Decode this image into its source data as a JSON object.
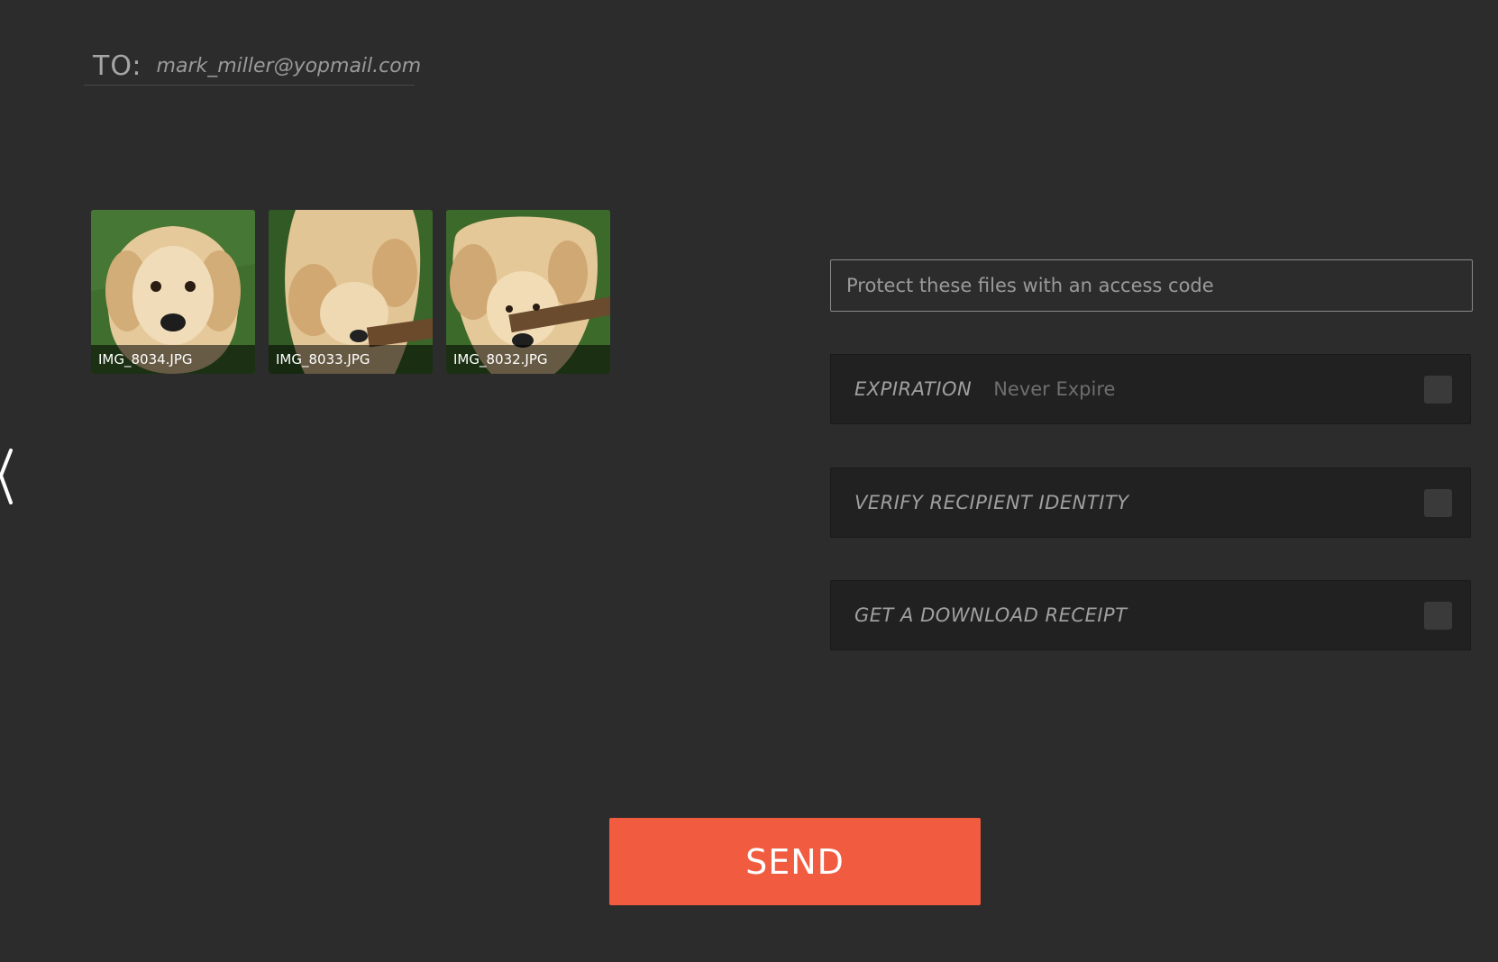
{
  "recipient": {
    "label": "TO:",
    "email": "mark_miller@yopmail.com"
  },
  "attachments": [
    {
      "filename": "IMG_8034.JPG"
    },
    {
      "filename": "IMG_8033.JPG"
    },
    {
      "filename": "IMG_8032.JPG"
    }
  ],
  "access_code": {
    "placeholder": "Protect these files with an access code"
  },
  "options": {
    "expiration": {
      "label": "EXPIRATION",
      "value": "Never Expire"
    },
    "verify": {
      "label": "VERIFY RECIPIENT IDENTITY"
    },
    "receipt": {
      "label": "GET A DOWNLOAD RECEIPT"
    }
  },
  "send": {
    "label": "SEND"
  },
  "colors": {
    "background": "#2c2c2c",
    "accent": "#f15b40",
    "option_background": "#212121"
  },
  "icons": {
    "back": "chevron-left-icon",
    "checkbox": "checkbox-icon"
  }
}
